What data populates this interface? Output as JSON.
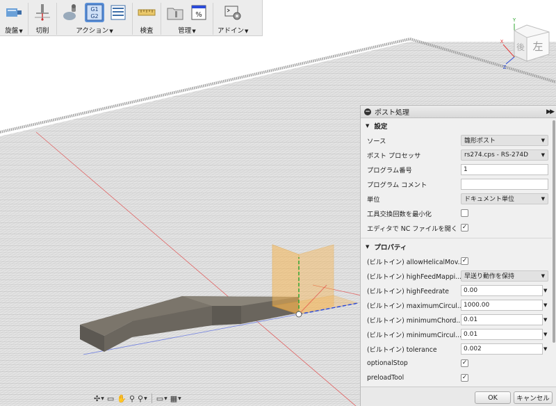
{
  "toolbar": {
    "groups": [
      {
        "label": "旋盤",
        "has_menu": true
      },
      {
        "label": "切削",
        "has_menu": false
      },
      {
        "label": "アクション",
        "has_menu": true,
        "g1g2_text": "G1 G2"
      },
      {
        "label": "検査",
        "has_menu": false
      },
      {
        "label": "管理",
        "has_menu": true,
        "percent_text": "%"
      },
      {
        "label": "アドイン",
        "has_menu": true
      }
    ]
  },
  "viewcube": {
    "face_top": "後",
    "face_right": "左",
    "axis_x": "X",
    "axis_y": "Y",
    "axis_z": "Z"
  },
  "panel": {
    "title": "ポスト処理",
    "sections": {
      "settings": "設定",
      "properties": "プロパティ"
    },
    "settings": {
      "source": {
        "label": "ソース",
        "value": "雛形ポスト"
      },
      "post_processor": {
        "label": "ポスト プロセッサ",
        "value": "rs274.cps - RS-274D"
      },
      "program_number": {
        "label": "プログラム番号",
        "value": "1"
      },
      "program_comment": {
        "label": "プログラム コメント",
        "value": ""
      },
      "unit": {
        "label": "単位",
        "value": "ドキュメント単位"
      },
      "minimize_tool_changes": {
        "label": "工具交換回数を最小化",
        "checked": false
      },
      "open_nc_in_editor": {
        "label": "エディタで NC ファイルを開く",
        "checked": true
      }
    },
    "properties": [
      {
        "label": "(ビルトイン) allowHelicalMov...",
        "type": "check",
        "checked": true
      },
      {
        "label": "(ビルトイン) highFeedMappi...",
        "type": "select",
        "value": "早送り動作を保持"
      },
      {
        "label": "(ビルトイン) highFeedrate",
        "type": "combo",
        "value": "0.00"
      },
      {
        "label": "(ビルトイン) maximumCircul...",
        "type": "combo",
        "value": "1000.00"
      },
      {
        "label": "(ビルトイン) minimumChord...",
        "type": "combo",
        "value": "0.01"
      },
      {
        "label": "(ビルトイン) minimumCircul...",
        "type": "combo",
        "value": "0.01"
      },
      {
        "label": "(ビルトイン) tolerance",
        "type": "combo",
        "value": "0.002"
      },
      {
        "label": "optionalStop",
        "type": "check",
        "checked": true
      },
      {
        "label": "preloadTool",
        "type": "check",
        "checked": true
      }
    ],
    "ok_label": "OK",
    "cancel_label": "キャンセル"
  },
  "colors": {
    "accent": "#5b8fd6",
    "grid_line": "#b5b5b5",
    "part_top": "#7a746a",
    "part_side": "#5e5a53",
    "plane": "#f5b452",
    "axis_x": "#e23a3a",
    "axis_y": "#2ea42e",
    "axis_z": "#2a4ad8"
  }
}
